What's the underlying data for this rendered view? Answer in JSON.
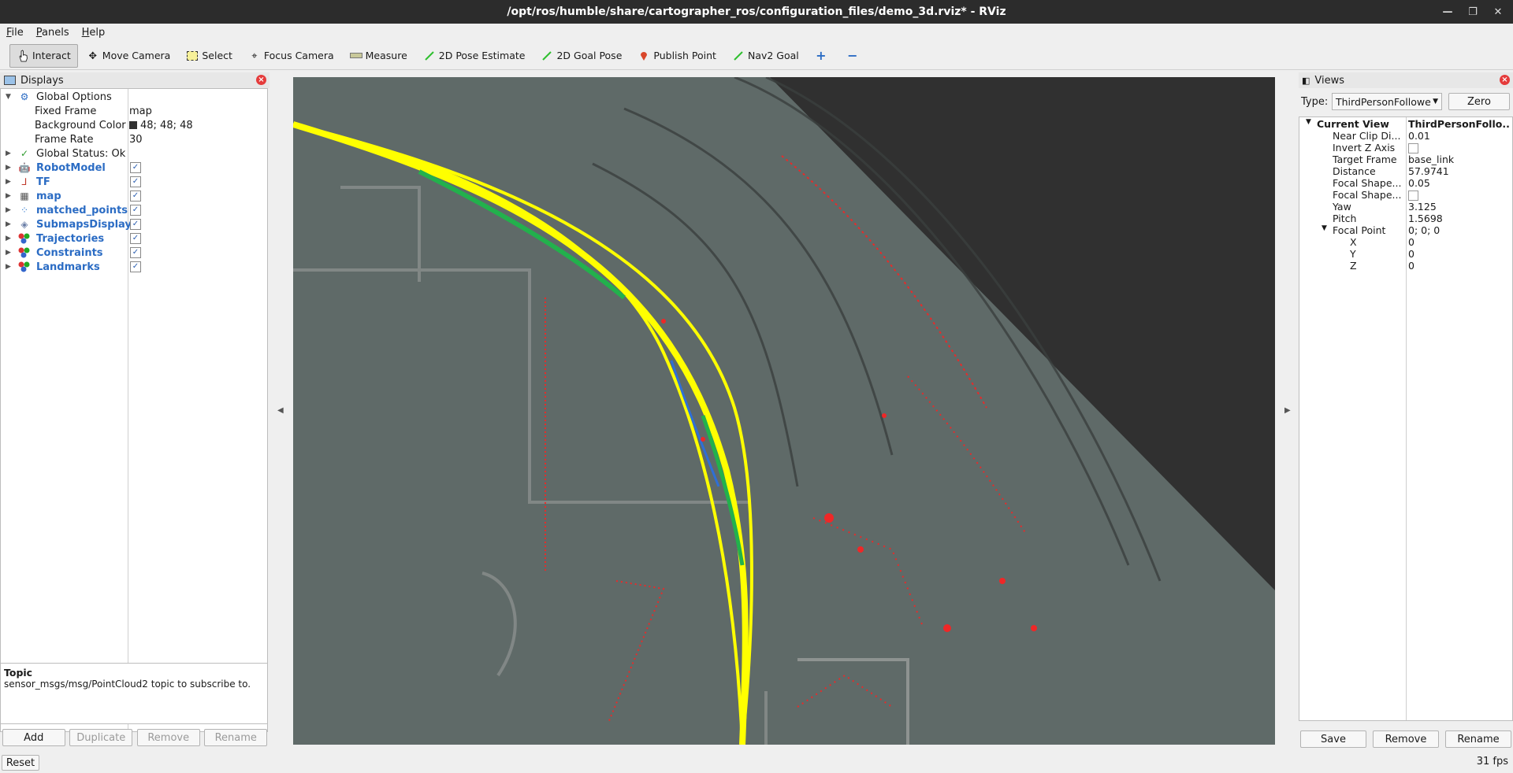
{
  "window": {
    "title": "/opt/ros/humble/share/cartographer_ros/configuration_files/demo_3d.rviz* - RViz"
  },
  "menu": [
    "File",
    "Panels",
    "Help"
  ],
  "toolbar": {
    "interact": "Interact",
    "move_camera": "Move Camera",
    "select": "Select",
    "focus_camera": "Focus Camera",
    "measure": "Measure",
    "pose_estimate": "2D Pose Estimate",
    "goal_pose": "2D Goal Pose",
    "publish_point": "Publish Point",
    "nav2_goal": "Nav2 Goal"
  },
  "displays": {
    "title": "Displays",
    "global_options": "Global Options",
    "fixed_frame_label": "Fixed Frame",
    "fixed_frame": "map",
    "bg_color_label": "Background Color",
    "bg_color": "48; 48; 48",
    "frame_rate_label": "Frame Rate",
    "frame_rate": "30",
    "global_status": "Global Status: Ok",
    "items": [
      {
        "label": "RobotModel",
        "checked": "✓"
      },
      {
        "label": "TF",
        "checked": "✓"
      },
      {
        "label": "map",
        "checked": "✓"
      },
      {
        "label": "matched_points",
        "checked": "✓"
      },
      {
        "label": "SubmapsDisplay",
        "checked": "✓"
      },
      {
        "label": "Trajectories",
        "checked": "✓"
      },
      {
        "label": "Constraints",
        "checked": "✓"
      },
      {
        "label": "Landmarks",
        "checked": "✓"
      }
    ],
    "description_title": "Topic",
    "description": "sensor_msgs/msg/PointCloud2 topic to subscribe to.",
    "buttons": {
      "add": "Add",
      "duplicate": "Duplicate",
      "remove": "Remove",
      "rename": "Rename"
    }
  },
  "views": {
    "title": "Views",
    "type_label": "Type:",
    "type_value": "ThirdPersonFollowe",
    "zero": "Zero",
    "current_view_label": "Current View",
    "current_view_value": "ThirdPersonFollo...",
    "props": {
      "near_clip_label": "Near Clip Di...",
      "near_clip": "0.01",
      "invert_z_label": "Invert Z Axis",
      "target_frame_label": "Target Frame",
      "target_frame": "base_link",
      "distance_label": "Distance",
      "distance": "57.9741",
      "focal_size_label": "Focal Shape...",
      "focal_size": "0.05",
      "focal_fixed_label": "Focal Shape...",
      "yaw_label": "Yaw",
      "yaw": "3.125",
      "pitch_label": "Pitch",
      "pitch": "1.5698",
      "focal_point_label": "Focal Point",
      "focal_point": "0; 0; 0",
      "x_label": "X",
      "x": "0",
      "y_label": "Y",
      "y": "0",
      "z_label": "Z",
      "z": "0"
    },
    "buttons": {
      "save": "Save",
      "remove": "Remove",
      "rename": "Rename"
    }
  },
  "status": {
    "reset": "Reset",
    "fps": "31 fps"
  },
  "colors": {
    "map_gray": "#5f6a68",
    "trajectory": "#ffff00",
    "points": "#ff2020",
    "background": "#303030"
  }
}
